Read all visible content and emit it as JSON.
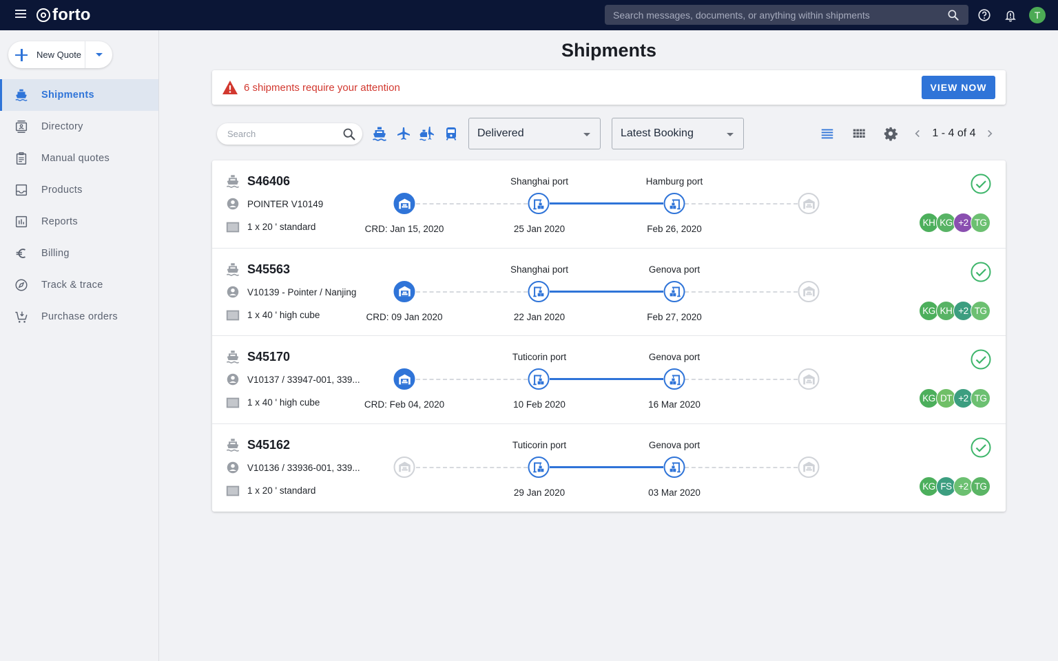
{
  "app": {
    "brand": "forto",
    "global_search_placeholder": "Search messages, documents, or anything within shipments",
    "user_initial": "T"
  },
  "sidebar": {
    "new_quote_label": "New Quote",
    "items": [
      {
        "label": "Shipments",
        "icon": "ship-icon",
        "active": true
      },
      {
        "label": "Directory",
        "icon": "contact-card-icon",
        "active": false
      },
      {
        "label": "Manual quotes",
        "icon": "clipboard-icon",
        "active": false
      },
      {
        "label": "Products",
        "icon": "inbox-icon",
        "active": false
      },
      {
        "label": "Reports",
        "icon": "bar-chart-icon",
        "active": false
      },
      {
        "label": "Billing",
        "icon": "euro-icon",
        "active": false
      },
      {
        "label": "Track & trace",
        "icon": "compass-icon",
        "active": false
      },
      {
        "label": "Purchase orders",
        "icon": "cart-icon",
        "active": false
      }
    ]
  },
  "main": {
    "title": "Shipments",
    "alert": {
      "text": "6 shipments require your attention",
      "button": "VIEW NOW"
    },
    "toolbar": {
      "search_placeholder": "Search",
      "mode_filters": [
        "ocean",
        "air",
        "ocean-air",
        "rail"
      ],
      "status_filter": "Delivered",
      "sort": "Latest Booking",
      "pager": "1 - 4 of 4"
    },
    "shipments": [
      {
        "id": "S46406",
        "reference": "POINTER V10149",
        "container": "1 x 20 ' standard",
        "origin_date": "CRD: Jan 15, 2020",
        "pol": "Shanghai port",
        "pol_date": "25 Jan 2020",
        "pod": "Hamburg port",
        "pod_date": "Feb 26, 2020",
        "origin_active": true,
        "status": "delivered",
        "team": [
          {
            "initials": "KH",
            "color": "#4caf5c"
          },
          {
            "initials": "KG",
            "color": "#58b365"
          },
          {
            "initials": "+2",
            "color": "#8a4fb0"
          },
          {
            "initials": "TG",
            "color": "#6cc071"
          }
        ]
      },
      {
        "id": "S45563",
        "reference": "V10139 - Pointer / Nanjing",
        "container": "1 x 40 ' high cube",
        "origin_date": "CRD: 09 Jan 2020",
        "pol": "Shanghai port",
        "pol_date": "22 Jan 2020",
        "pod": "Genova port",
        "pod_date": "Feb 27, 2020",
        "origin_active": true,
        "status": "delivered",
        "team": [
          {
            "initials": "KG",
            "color": "#4caf5c"
          },
          {
            "initials": "KH",
            "color": "#58b365"
          },
          {
            "initials": "+2",
            "color": "#3c9e80"
          },
          {
            "initials": "TG",
            "color": "#6cc071"
          }
        ]
      },
      {
        "id": "S45170",
        "reference": "V10137 / 33947-001, 339...",
        "container": "1 x 40 ' high cube",
        "origin_date": "CRD: Feb 04, 2020",
        "pol": "Tuticorin port",
        "pol_date": "10 Feb 2020",
        "pod": "Genova port",
        "pod_date": "16 Mar 2020",
        "origin_active": true,
        "status": "delivered",
        "team": [
          {
            "initials": "KG",
            "color": "#4caf5c"
          },
          {
            "initials": "DT",
            "color": "#70bf67"
          },
          {
            "initials": "+2",
            "color": "#3c9e80"
          },
          {
            "initials": "TG",
            "color": "#6cc071"
          }
        ]
      },
      {
        "id": "S45162",
        "reference": "V10136 / 33936-001, 339...",
        "container": "1 x 20 ' standard",
        "origin_date": "",
        "pol": "Tuticorin port",
        "pol_date": "29 Jan 2020",
        "pod": "Genova port",
        "pod_date": "03 Mar 2020",
        "origin_active": false,
        "status": "delivered",
        "team": [
          {
            "initials": "KG",
            "color": "#4caf5c"
          },
          {
            "initials": "FS",
            "color": "#3c9e80"
          },
          {
            "initials": "+2",
            "color": "#6cc071"
          },
          {
            "initials": "TG",
            "color": "#5bb565"
          }
        ]
      }
    ]
  },
  "colors": {
    "brand_navy": "#0b1636",
    "accent_blue": "#2f74d8",
    "alert_red": "#d2382f",
    "success_green": "#3db56a"
  }
}
